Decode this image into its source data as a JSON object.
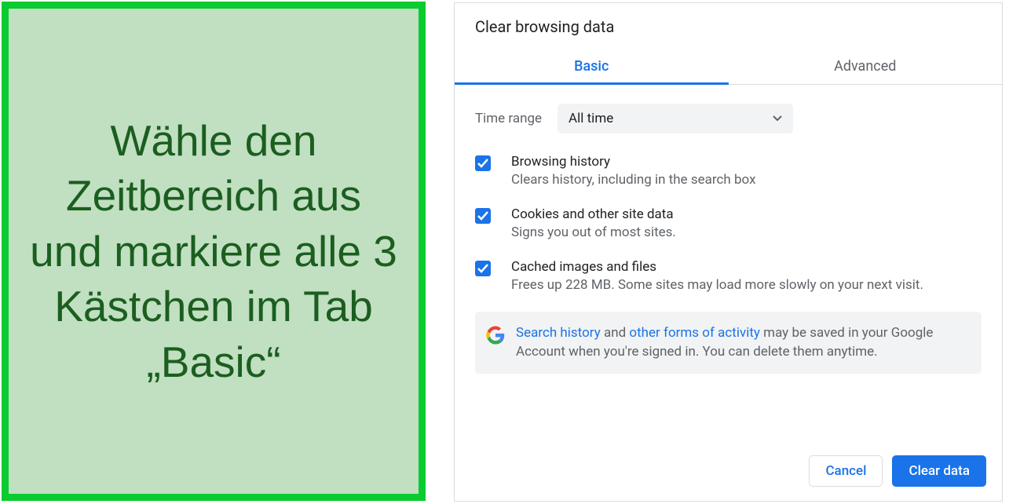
{
  "instruction": {
    "text": "Wähle den Zeitbereich aus und markiere alle 3 Kästchen im Tab „Basic“"
  },
  "dialog": {
    "title": "Clear browsing data",
    "tabs": {
      "basic": "Basic",
      "advanced": "Advanced"
    },
    "time_range": {
      "label": "Time range",
      "value": "All time"
    },
    "options": [
      {
        "title": "Browsing history",
        "desc": "Clears history, including in the search box"
      },
      {
        "title": "Cookies and other site data",
        "desc": "Signs you out of most sites."
      },
      {
        "title": "Cached images and files",
        "desc": "Frees up 228 MB. Some sites may load more slowly on your next visit."
      }
    ],
    "info": {
      "link1": "Search history",
      "mid": " and ",
      "link2": "other forms of activity",
      "rest": " may be saved in your Google Account when you're signed in. You can delete them anytime."
    },
    "buttons": {
      "cancel": "Cancel",
      "clear": "Clear data"
    }
  }
}
